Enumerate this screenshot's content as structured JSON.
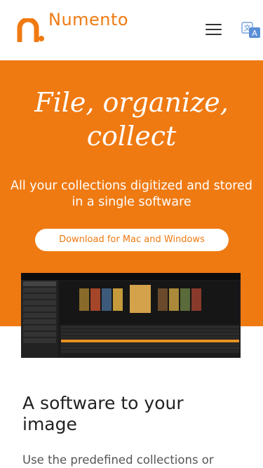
{
  "header": {
    "brand": "Numento",
    "menu_icon": "hamburger-menu-icon",
    "language_icon": "translate-icon",
    "accent": "#f07a12"
  },
  "hero": {
    "title": "File, organize, collect",
    "subtitle": "All your collections digitized and stored in a single software",
    "cta_label": "Download for Mac and Windows",
    "background": "#ef7a12"
  },
  "section": {
    "title": "A software to your image",
    "text": "Use the predefined collections or"
  }
}
